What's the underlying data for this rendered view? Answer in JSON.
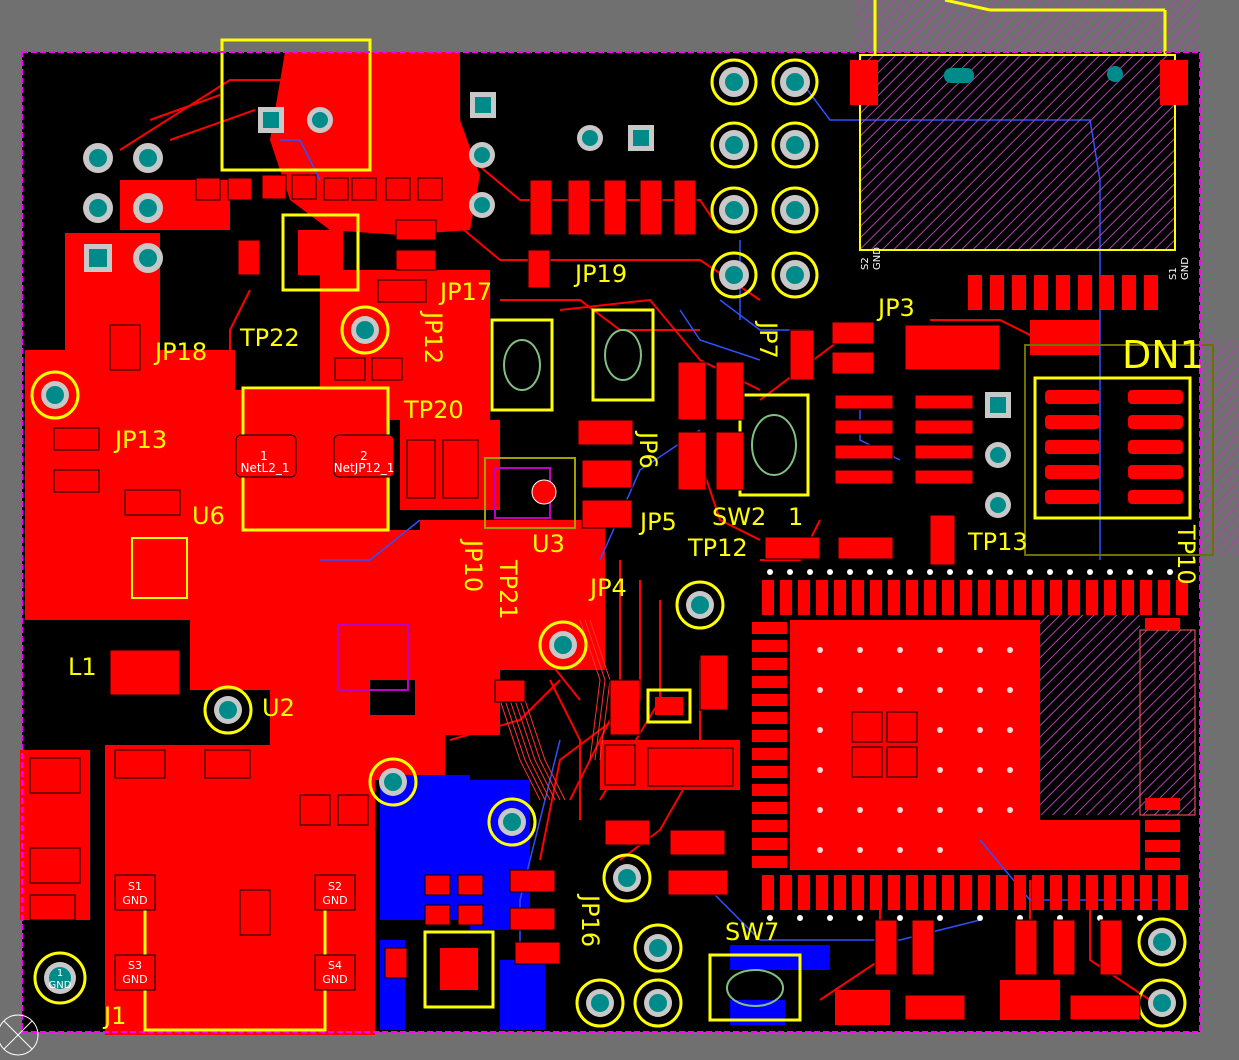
{
  "colors": {
    "background": "#707070",
    "board": "#000000",
    "top_copper": "#FF0000",
    "bottom_copper": "#0000FF",
    "silkscreen": "#FFFF00",
    "drill": "#008B8B",
    "outline": "#FF00FF",
    "keepout": "#9932CC"
  },
  "designators": {
    "jp19": "JP19",
    "jp17": "JP17",
    "jp18": "JP18",
    "tp22": "TP22",
    "jp12": "JP12",
    "jp3": "JP3",
    "jp7": "JP7",
    "dn1": "DN1",
    "jp13": "JP13",
    "tp20": "TP20",
    "jp6": "JP6",
    "jp5": "JP5",
    "sw2": "SW2",
    "tp12": "TP12",
    "tp13": "TP13",
    "tp10": "TP10",
    "u6": "U6",
    "u3": "U3",
    "jp10": "JP10",
    "tp21": "TP21",
    "jp4": "JP4",
    "l1": "L1",
    "u2": "U2",
    "sw7": "SW7",
    "jp16": "JP16",
    "j1": "J1"
  },
  "pad_labels": {
    "netl2_num": "1",
    "netl2_name": "NetL2_1",
    "netjp12_num": "2",
    "netjp12_name": "NetJP12_1",
    "s1": "S1",
    "s2": "S2",
    "s3": "S3",
    "s4": "S4",
    "gnd": "GND",
    "gnd_pin_num": "1",
    "gnd_pin_name": "GND",
    "sw2_pin": "1"
  }
}
